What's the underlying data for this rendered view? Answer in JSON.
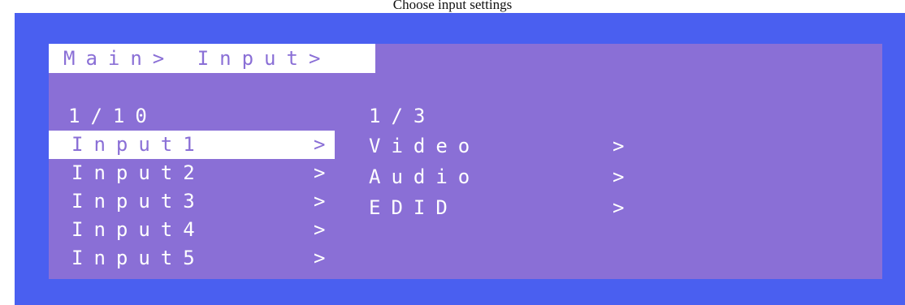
{
  "caption": "Choose input settings",
  "breadcrumb": "Main> Input>",
  "left_page": "1/10",
  "right_page": "1/3",
  "inputs": [
    {
      "label": "Input1",
      "chevron": ">"
    },
    {
      "label": "Input2",
      "chevron": ">"
    },
    {
      "label": "Input3",
      "chevron": ">"
    },
    {
      "label": "Input4",
      "chevron": ">"
    },
    {
      "label": "Input5",
      "chevron": ">"
    }
  ],
  "submenu": [
    {
      "label": "Video",
      "chevron": ">"
    },
    {
      "label": "Audio",
      "chevron": ">"
    },
    {
      "label": "EDID",
      "chevron": ">"
    }
  ],
  "colors": {
    "frame": "#4a5ff0",
    "screen": "#8a6fd6",
    "highlight": "#ffffff"
  }
}
